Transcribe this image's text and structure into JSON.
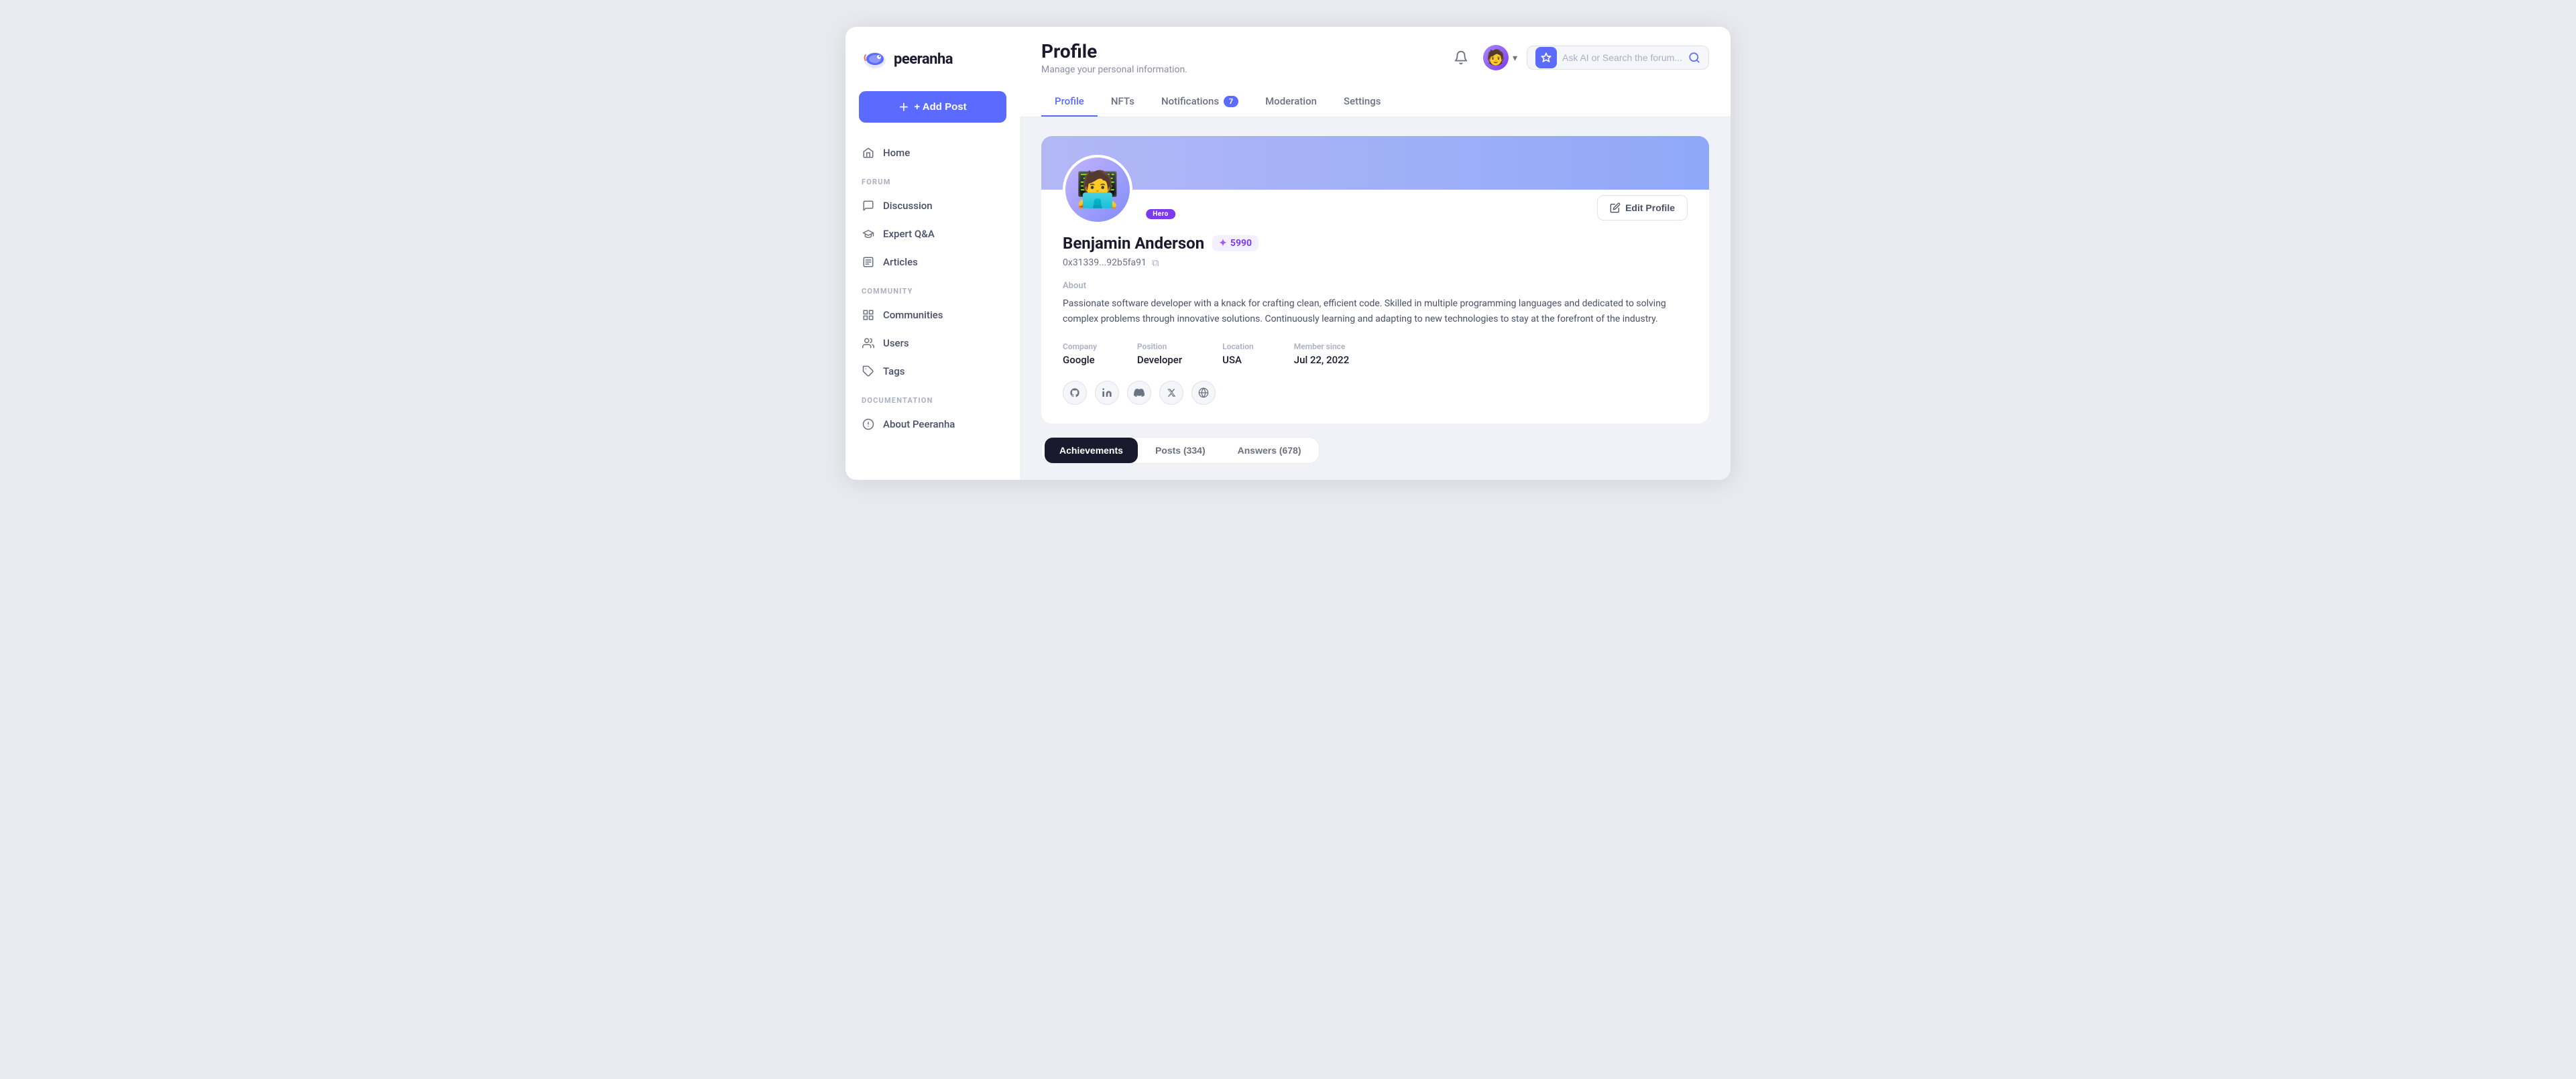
{
  "sidebar": {
    "logo_text": "peeranha",
    "add_post_label": "+ Add Post",
    "nav_items": [
      {
        "id": "home",
        "label": "Home",
        "icon": "home"
      }
    ],
    "sections": [
      {
        "label": "FORUM",
        "items": [
          {
            "id": "discussion",
            "label": "Discussion",
            "icon": "chat"
          },
          {
            "id": "expert-qa",
            "label": "Expert Q&A",
            "icon": "graduation"
          },
          {
            "id": "articles",
            "label": "Articles",
            "icon": "article"
          }
        ]
      },
      {
        "label": "COMMUNITY",
        "items": [
          {
            "id": "communities",
            "label": "Communities",
            "icon": "grid"
          },
          {
            "id": "users",
            "label": "Users",
            "icon": "users"
          },
          {
            "id": "tags",
            "label": "Tags",
            "icon": "tag"
          }
        ]
      },
      {
        "label": "DOCUMENTATION",
        "items": [
          {
            "id": "about",
            "label": "About Peeranha",
            "icon": "info"
          }
        ]
      }
    ]
  },
  "topbar": {
    "page_title": "Profile",
    "page_subtitle": "Manage your personal information.",
    "search_placeholder": "Ask AI or Search the forum..."
  },
  "tabs": [
    {
      "id": "profile",
      "label": "Profile",
      "active": true,
      "badge": null
    },
    {
      "id": "nfts",
      "label": "NFTs",
      "active": false,
      "badge": null
    },
    {
      "id": "notifications",
      "label": "Notifications",
      "active": false,
      "badge": "7"
    },
    {
      "id": "moderation",
      "label": "Moderation",
      "active": false,
      "badge": null
    },
    {
      "id": "settings",
      "label": "Settings",
      "active": false,
      "badge": null
    }
  ],
  "profile": {
    "name": "Benjamin Anderson",
    "points": "5990",
    "address": "0x31339...92b5fa91",
    "badge": "Hero",
    "about_label": "About",
    "about_text": "Passionate software developer with a knack for crafting clean, efficient code. Skilled in multiple programming languages and dedicated to solving complex problems through innovative solutions. Continuously learning and adapting to new technologies to stay at the forefront of the industry.",
    "company_label": "Company",
    "company_value": "Google",
    "position_label": "Position",
    "position_value": "Developer",
    "location_label": "Location",
    "location_value": "USA",
    "member_since_label": "Member since",
    "member_since_value": "Jul 22, 2022",
    "edit_profile_label": "Edit Profile",
    "social_links": [
      {
        "id": "github",
        "icon": "github",
        "symbol": "⌥"
      },
      {
        "id": "linkedin",
        "icon": "linkedin",
        "symbol": "in"
      },
      {
        "id": "discord",
        "icon": "discord",
        "symbol": "💬"
      },
      {
        "id": "twitter",
        "icon": "twitter",
        "symbol": "𝕏"
      },
      {
        "id": "website",
        "icon": "globe",
        "symbol": "🌐"
      }
    ]
  },
  "bottom_tabs": [
    {
      "id": "achievements",
      "label": "Achievements",
      "active": true
    },
    {
      "id": "posts",
      "label": "Posts  (334)",
      "active": false
    },
    {
      "id": "answers",
      "label": "Answers (678)",
      "active": false
    }
  ]
}
